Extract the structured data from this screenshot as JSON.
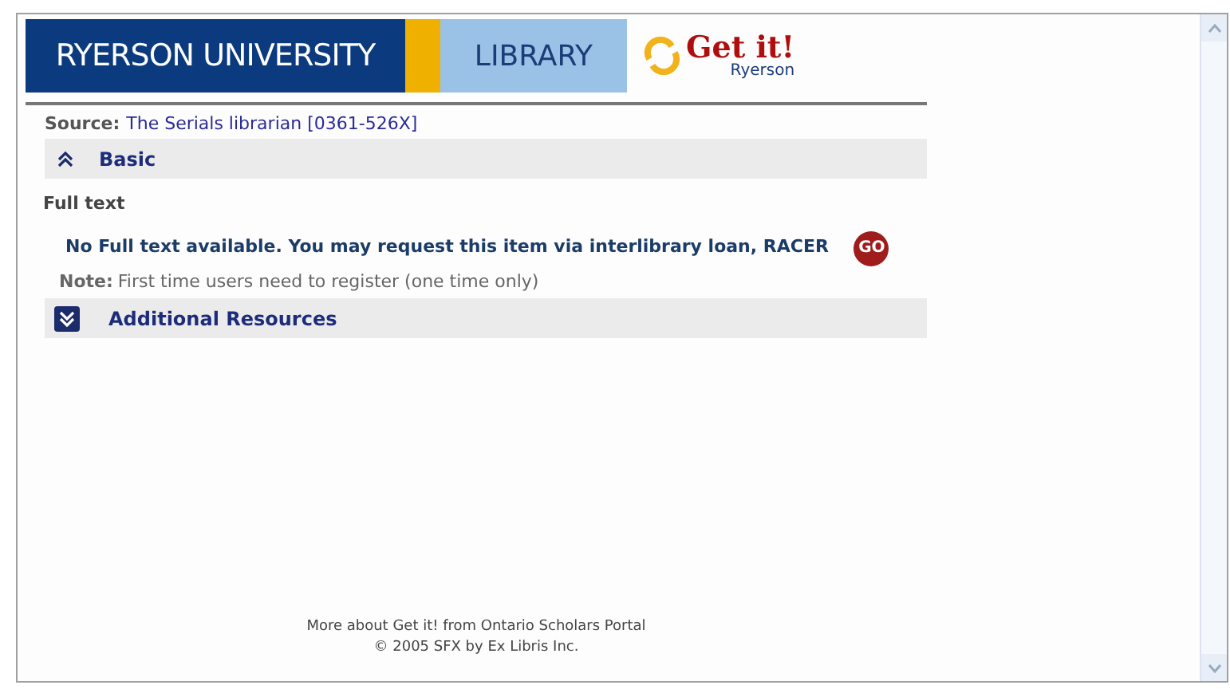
{
  "banner": {
    "university": "RYERSON UNIVERSITY",
    "library": "LIBRARY",
    "logo_title": "Get it!",
    "logo_subtitle": "Ryerson"
  },
  "source": {
    "label": "Source:",
    "value": "The Serials librarian [0361-526X]"
  },
  "sections": [
    {
      "title": "Basic",
      "expanded": true
    },
    {
      "title": "Additional Resources",
      "expanded": false
    }
  ],
  "full_text": {
    "heading": "Full text",
    "message": "No Full text available. You may request this item via interlibrary loan, RACER",
    "button": "GO",
    "note_label": "Note:",
    "note": "First time users need to register (one time only)"
  },
  "footer": [
    "More about Get it! from Ontario Scholars Portal",
    "© 2005 SFX by Ex Libris Inc."
  ]
}
